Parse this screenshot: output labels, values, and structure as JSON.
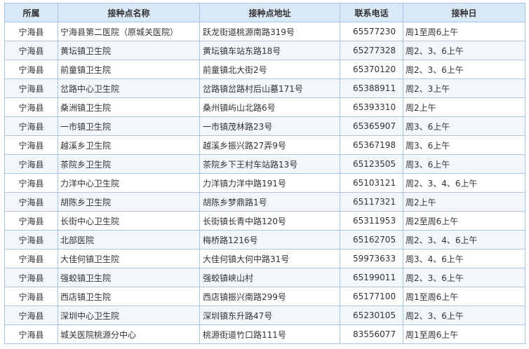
{
  "headers": [
    "所属",
    "接种点名称",
    "接种点地址",
    "联系电话",
    "接种日"
  ],
  "rows": [
    [
      "宁海县",
      "宁海县第二医院（原城关医院）",
      "跃龙街道桃源南路319号",
      "65577230",
      "周1至周6上午"
    ],
    [
      "宁海县",
      "黄坛镇卫生院",
      "黄坛镇车站东路18号",
      "65277328",
      "周2、3、6上午"
    ],
    [
      "宁海县",
      "前童镇卫生院",
      "前童镇北大街2号",
      "65370120",
      "周2、3、6上午"
    ],
    [
      "宁海县",
      "岔路中心卫生院",
      "岔路镇岔路村后山墓171号",
      "65388911",
      "周2、3上午"
    ],
    [
      "宁海县",
      "桑洲镇卫生院",
      "桑州镇屿山北路6号",
      "65393310",
      "周2上午"
    ],
    [
      "宁海县",
      "一市镇卫生院",
      "一市镇茂林路23号",
      "65365907",
      "周3、6上午"
    ],
    [
      "宁海县",
      "越溪乡卫生院",
      "越溪乡振兴路27弄9号",
      "65367198",
      "周3、6上午"
    ],
    [
      "宁海县",
      "茶院乡卫生院",
      "茶院乡下王村车站路13号",
      "65123505",
      "周3、6上午"
    ],
    [
      "宁海县",
      "力洋中心卫生院",
      "力洋镇力洋中路191号",
      "65103121",
      "周2、3、4、6上午"
    ],
    [
      "宁海县",
      "胡陈乡卫生院",
      "胡陈乡梦鼎路1号",
      "65117321",
      "周2上午"
    ],
    [
      "宁海县",
      "长街中心卫生院",
      "长街镇长青中路120号",
      "65311953",
      "周2至周6上午"
    ],
    [
      "宁海县",
      "北部医院",
      "梅桥路1216号",
      "65162705",
      "周2、3、4、6上午"
    ],
    [
      "宁海县",
      "大佳何镇卫生院",
      "大佳何镇大何中路31号",
      "59973633",
      "周3、4、6上午"
    ],
    [
      "宁海县",
      "强蛟镇卫生院",
      "强蛟镇峡山村",
      "65199011",
      "周2、3、6上午"
    ],
    [
      "宁海县",
      "西店镇卫生院",
      "西店镇振兴南路299号",
      "65177100",
      "周1至周6上午"
    ],
    [
      "宁海县",
      "深圳中心卫生院",
      "深圳镇东升路47号",
      "65230105",
      "周2、3、6上午"
    ],
    [
      "宁海县",
      "城关医院桃源分中心",
      "桃源街道竹口路111号",
      "83556077",
      "周1至周6上午"
    ]
  ]
}
